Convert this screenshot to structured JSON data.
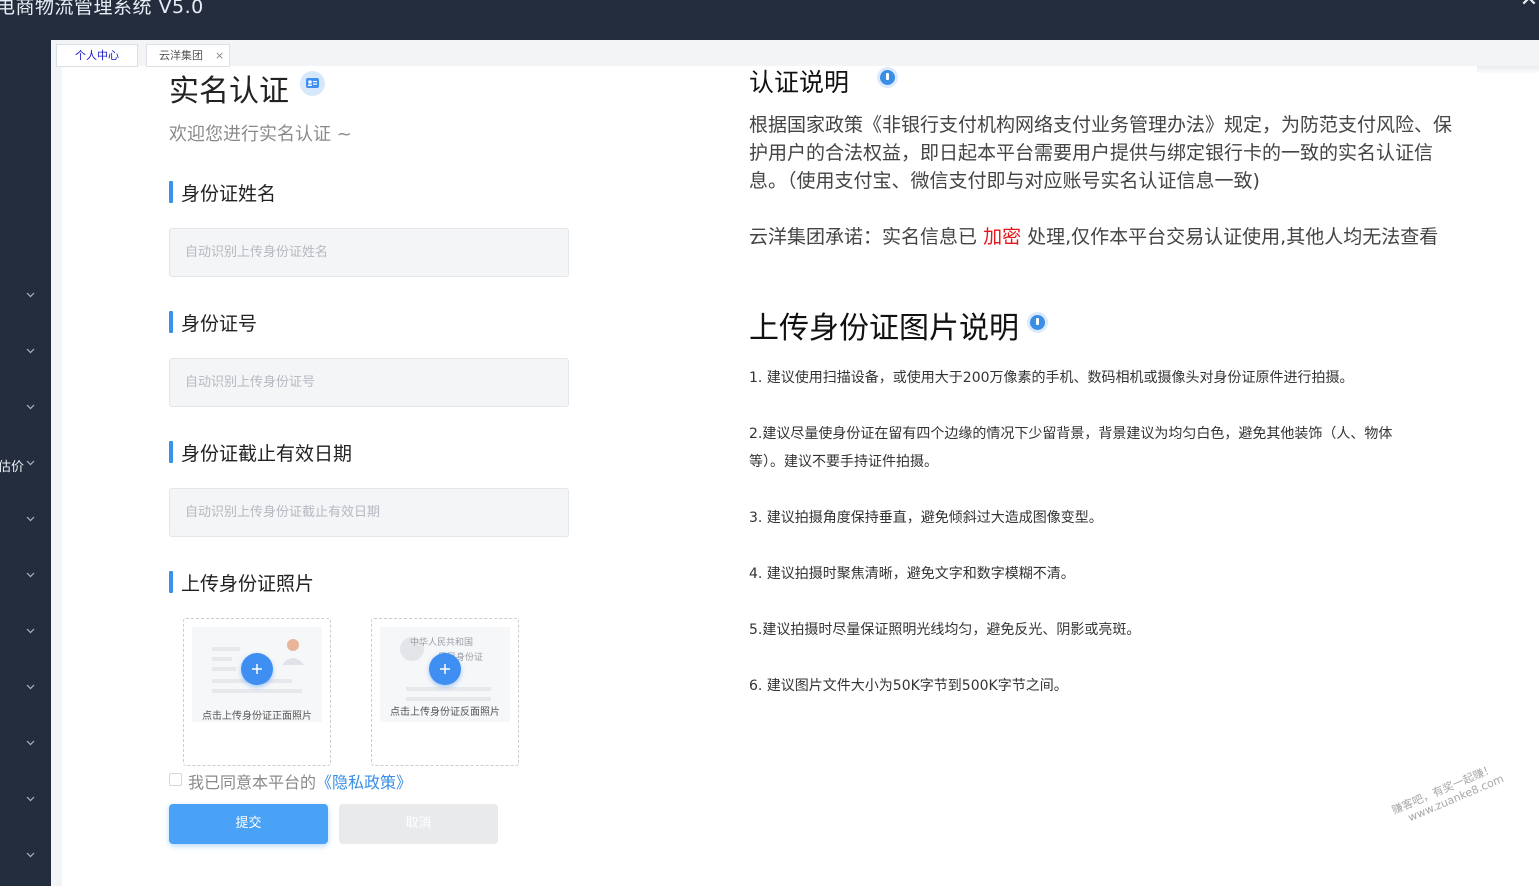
{
  "app": {
    "title": "电商物流管理系统 V5.0",
    "close": "✕"
  },
  "tabs": [
    {
      "label": "个人中心"
    },
    {
      "label": "云洋集团",
      "close": "×"
    }
  ],
  "sidebar": {
    "partial_label": "估价"
  },
  "form": {
    "title": "实名认证",
    "subtitle": "欢迎您进行实名认证 ~",
    "name_label": "身份证姓名",
    "name_placeholder": "自动识别上传身份证姓名",
    "id_label": "身份证号",
    "id_placeholder": "自动识别上传身份证号",
    "expiry_label": "身份证截止有效日期",
    "expiry_placeholder": "自动识别上传身份证截止有效日期",
    "upload_label": "上传身份证照片",
    "upload_front": "点击上传身份证正面照片",
    "upload_back": "点击上传身份证反面照片",
    "back_card_line1": "中华人民共和国",
    "back_card_line2": "居民身份证",
    "agree_text": "我已同意本平台的",
    "agree_link": "《隐私政策》",
    "submit": "提交",
    "cancel": "取消"
  },
  "info": {
    "auth_title": "认证说明",
    "policy_text": "根据国家政策《非银行支付机构网络支付业务管理办法》规定，为防范支付风险、保护用户的合法权益，即日起本平台需要用户提供与绑定银行卡的一致的实名认证信息。（使用支付宝、微信支付即与对应账号实名认证信息一致)",
    "promise_prefix": "云洋集团承诺：实名信息已",
    "promise_highlight": "加密",
    "promise_suffix": "处理,仅作本平台交易认证使用,其他人均无法查看",
    "upload_title": "上传身份证图片说明",
    "tips": [
      "1. 建议使用扫描设备，或使用大于200万像素的手机、数码相机或摄像头对身份证原件进行拍摄。",
      "2.建议尽量使身份证在留有四个边缘的情况下少留背景，背景建议为均匀白色，避免其他装饰（人、物体等）。建议不要手持证件拍摄。",
      "3. 建议拍摄角度保持垂直，避免倾斜过大造成图像变型。",
      "4. 建议拍摄时聚焦清晰，避免文字和数字模糊不清。",
      "5.建议拍摄时尽量保证照明光线均匀，避免反光、阴影或亮斑。",
      "6. 建议图片文件大小为50K字节到500K字节之间。"
    ]
  },
  "watermark": {
    "line1": "赚客吧，有奖一起赚！",
    "line2": "www.zuanke8.com"
  },
  "colors": {
    "sidebar": "#232d3e",
    "accent": "#3a92ee",
    "highlight": "#e5171a",
    "submit": "#4aa2f6"
  }
}
